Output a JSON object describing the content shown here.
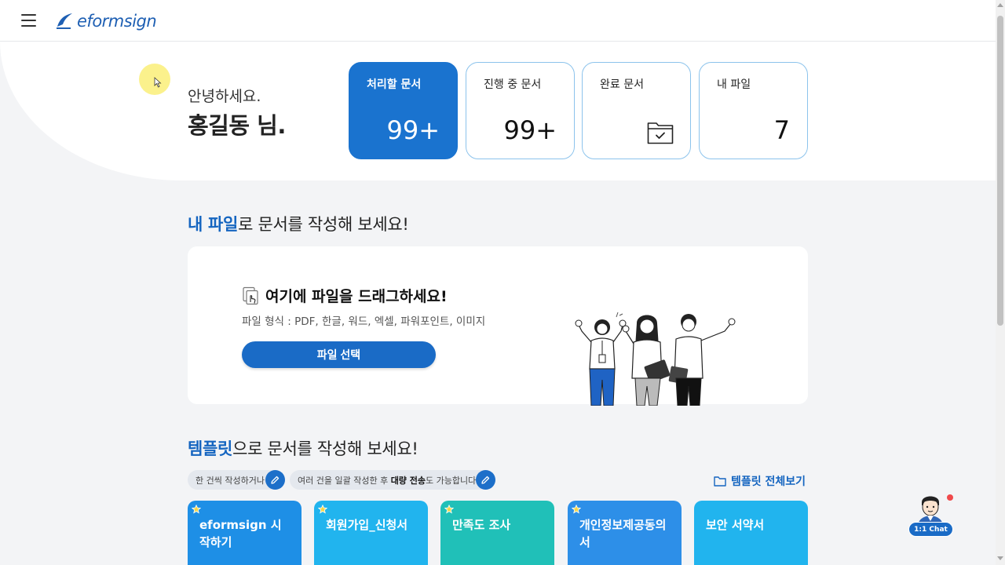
{
  "header": {
    "logo_text": "eformsign",
    "menu_icon": "hamburger-menu-icon"
  },
  "greeting": {
    "hello": "안녕하세요.",
    "name": "홍길동 님."
  },
  "stats": [
    {
      "label": "처리할 문서",
      "value": "99+"
    },
    {
      "label": "진행 중 문서",
      "value": "99+"
    },
    {
      "label": "완료 문서",
      "icon": "folder-check-icon"
    },
    {
      "label": "내 파일",
      "value": "7"
    }
  ],
  "upload_section": {
    "title_highlight": "내 파일",
    "title_rest": "로 문서를 작성해 보세요!",
    "drag_text": "여기에 파일을 드래그하세요!",
    "formats": "파일 형식 : PDF, 한글, 워드, 엑셀, 파워포인트, 이미지",
    "button": "파일 선택"
  },
  "template_section": {
    "title_highlight": "템플릿",
    "title_rest": "으로 문서를 작성해 보세요!",
    "pill_one": "한 건씩 작성하거나",
    "pill_two_pre": "여러 건을 일괄 작성한 후 ",
    "pill_two_bold": "대량 전송",
    "pill_two_post": "도 가능합니다.",
    "view_all": "템플릿 전체보기",
    "templates": [
      {
        "name": "eformsign 시작하기",
        "color": "#1e8fe6"
      },
      {
        "name": "회원가입_신청서",
        "color": "#21b4ee"
      },
      {
        "name": "만족도 조사",
        "color": "#20c0b8"
      },
      {
        "name": "개인정보제공동의서",
        "color": "#2d8fe8"
      },
      {
        "name": "보안 서약서",
        "color": "#21b4ee"
      }
    ]
  },
  "chat": {
    "label": "1:1 Chat"
  },
  "colors": {
    "accent": "#1a73cf",
    "title_highlight": "#1565c0"
  }
}
